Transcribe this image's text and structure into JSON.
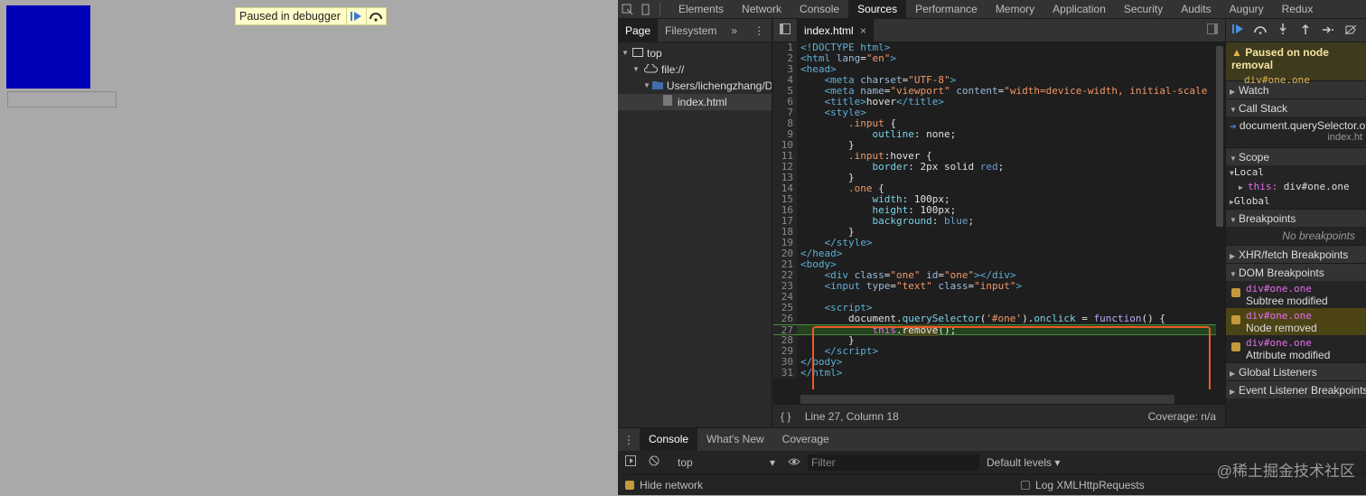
{
  "overlay": {
    "text": "Paused in debugger"
  },
  "devtools": {
    "tabs": [
      "Elements",
      "Network",
      "Console",
      "Sources",
      "Performance",
      "Memory",
      "Application",
      "Security",
      "Audits",
      "Augury",
      "Redux"
    ],
    "navigator": {
      "tabs": [
        "Page",
        "Filesystem"
      ],
      "tree": {
        "top": "top",
        "origin": "file://",
        "folder": "Users/lichengzhang/Do",
        "file": "index.html"
      }
    },
    "editor": {
      "tab": "index.html",
      "status_position": "Line 27, Column 18",
      "status_coverage": "Coverage: n/a"
    },
    "sidebar": {
      "pause_title": "Paused on node removal",
      "pause_node": "div#one.one",
      "sections": {
        "watch": "Watch",
        "callstack": "Call Stack",
        "scope": "Scope",
        "breakpoints": "Breakpoints",
        "xhr": "XHR/fetch Breakpoints",
        "dom": "DOM Breakpoints",
        "global": "Global Listeners",
        "event": "Event Listener Breakpoints"
      },
      "callstack_fn": "document.querySelector.on",
      "callstack_file": "index.ht",
      "scope_local": "Local",
      "scope_this_key": "this:",
      "scope_this_val": "div#one.one",
      "scope_global": "Global",
      "no_breakpoints": "No breakpoints",
      "dom_breakpoints": [
        {
          "node": "div#one.one",
          "type": "Subtree modified"
        },
        {
          "node": "div#one.one",
          "type": "Node removed"
        },
        {
          "node": "div#one.one",
          "type": "Attribute modified"
        }
      ]
    },
    "drawer": {
      "tabs": [
        "Console",
        "What's New",
        "Coverage"
      ],
      "context": "top",
      "filter_placeholder": "Filter",
      "levels": "Default levels ▾",
      "hide_network": "Hide network",
      "log_xhr": "Log XMLHttpRequests"
    }
  },
  "watermark": "@稀土掘金技术社区"
}
